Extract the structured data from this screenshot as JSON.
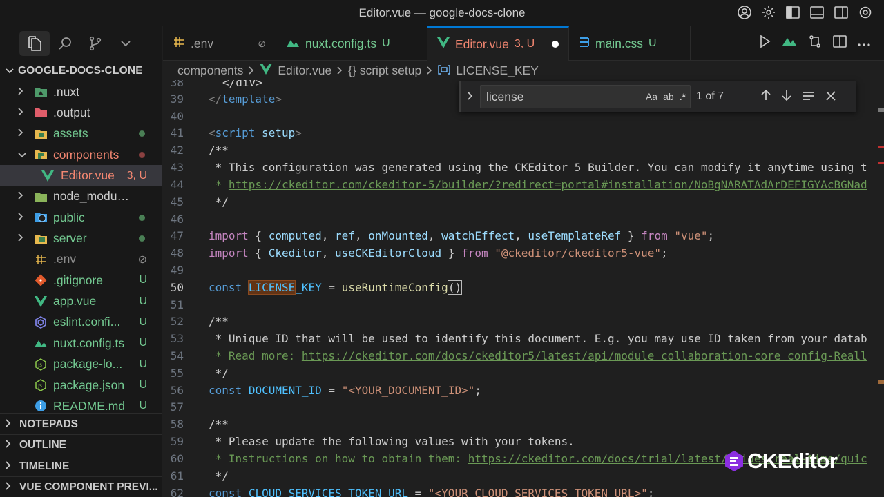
{
  "window": {
    "title": "Editor.vue — google-docs-clone"
  },
  "sidebar": {
    "root": "GOOGLE-DOCS-CLONE",
    "items": [
      {
        "label": ".nuxt",
        "status": "",
        "kind": "folder",
        "color": "#4e9a6a"
      },
      {
        "label": ".output",
        "status": "",
        "kind": "folder",
        "color": "#e05d6a"
      },
      {
        "label": "assets",
        "status": "",
        "kind": "folder",
        "color": "#e7b84e"
      },
      {
        "label": "components",
        "status": "",
        "kind": "folder-open",
        "color": "#e7b84e"
      },
      {
        "label": "Editor.vue",
        "status": "3, U",
        "kind": "vue"
      },
      {
        "label": "node_modules",
        "status": "",
        "kind": "folder",
        "color": "#8ab35a"
      },
      {
        "label": "public",
        "status": "",
        "kind": "folder",
        "color": "#3d9ee6"
      },
      {
        "label": "server",
        "status": "",
        "kind": "folder",
        "color": "#e7b84e"
      },
      {
        "label": ".env",
        "status": "⊘",
        "kind": "env"
      },
      {
        "label": ".gitignore",
        "status": "U",
        "kind": "git"
      },
      {
        "label": "app.vue",
        "status": "U",
        "kind": "vue"
      },
      {
        "label": "eslint.confi...",
        "status": "U",
        "kind": "eslint"
      },
      {
        "label": "nuxt.config.ts",
        "status": "U",
        "kind": "nuxt"
      },
      {
        "label": "package-lo...",
        "status": "U",
        "kind": "node"
      },
      {
        "label": "package.json",
        "status": "U",
        "kind": "node"
      },
      {
        "label": "README.md",
        "status": "U",
        "kind": "info"
      }
    ],
    "sections": [
      "NOTEPADS",
      "OUTLINE",
      "TIMELINE",
      "VUE COMPONENT PREVI..."
    ]
  },
  "tabs": [
    {
      "label": ".env",
      "status": "⊘"
    },
    {
      "label": "nuxt.config.ts",
      "status": "U"
    },
    {
      "label": "Editor.vue",
      "status": "3, U"
    },
    {
      "label": "main.css",
      "status": "U"
    }
  ],
  "breadcrumb": [
    "components",
    "Editor.vue",
    "{} script setup",
    "LICENSE_KEY"
  ],
  "find": {
    "query": "license",
    "opt_case": "Aa",
    "opt_word": "ab",
    "opt_regex": ".*",
    "count": "1 of 7"
  },
  "code": {
    "l38": "</div>",
    "l39_open": "</",
    "l39_tag": "template",
    "l39_close": ">",
    "l41_open": "<",
    "l41_tag": "script",
    "l41_attr": "setup",
    "l41_close": ">",
    "l42": "/**",
    "l43": " * This configuration was generated using the CKEditor 5 Builder. You can modify it anytime using t",
    "l44_pre": " * ",
    "l44_link": "https://ckeditor.com/ckeditor-5/builder/?redirect=portal#installation/NoBgNARATAdArDEFIGYAcBGNad",
    "l45": " */",
    "l47_import": "import",
    "l47_b1": " { ",
    "l47_n1": "computed",
    "l47_n2": "ref",
    "l47_n3": "onMounted",
    "l47_n4": "watchEffect",
    "l47_n5": "useTemplateRef",
    "l47_b2": " } ",
    "l47_from": "from",
    "l47_str": "\"vue\"",
    "l47_end": ";",
    "l48_import": "import",
    "l48_n1": "Ckeditor",
    "l48_n2": "useCKEditorCloud",
    "l48_from": "from",
    "l48_str": "\"@ckeditor/ckeditor5-vue\"",
    "l50_const": "const",
    "l50_hl": "LICENSE",
    "l50_rest": "_KEY",
    "l50_eq": " = ",
    "l50_fn": "useRuntimeConfig",
    "l50_paren": "()",
    "l52": "/**",
    "l53": " * Unique ID that will be used to identify this document. E.g. you may use ID taken from your datab",
    "l54_pre": " * Read more: ",
    "l54_link": "https://ckeditor.com/docs/ckeditor5/latest/api/module_collaboration-core_config-Reall",
    "l55": " */",
    "l56_const": "const",
    "l56_name": "DOCUMENT_ID",
    "l56_str": "\"<YOUR_DOCUMENT_ID>\"",
    "l58": "/**",
    "l59": " * Please update the following values with your tokens.",
    "l60_pre": " * Instructions on how to obtain them: ",
    "l60_link": "https://ckeditor.com/docs/trial/latest/guides/real-time/quic",
    "l61": " */",
    "l62_const": "const",
    "l62_name": "CLOUD_SERVICES_TOKEN_URL",
    "l62_str": "\"<YOUR_CLOUD_SERVICES_TOKEN_URL>\""
  },
  "line_numbers": [
    "38",
    "39",
    "40",
    "41",
    "42",
    "43",
    "44",
    "45",
    "46",
    "47",
    "48",
    "49",
    "50",
    "51",
    "52",
    "53",
    "54",
    "55",
    "56",
    "57",
    "58",
    "59",
    "60",
    "61",
    "62"
  ],
  "watermark": "CKEditor",
  "colors": {
    "accent": "#0078d4",
    "modified": "#f48771",
    "untracked": "#73c991",
    "vue": "#41b883"
  }
}
